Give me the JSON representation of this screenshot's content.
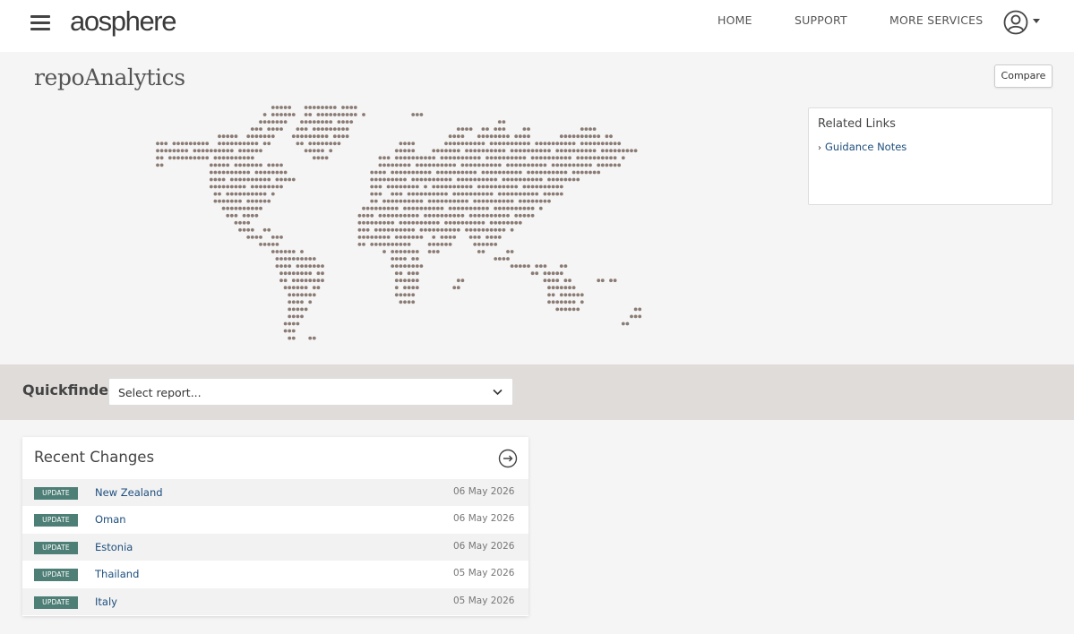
{
  "header": {
    "logo_text": "aosphere",
    "nav": [
      {
        "label": "HOME"
      },
      {
        "label": "SUPPORT"
      },
      {
        "label": "MORE SERVICES"
      }
    ]
  },
  "page": {
    "title": "repoAnalytics",
    "compare_label": "Compare"
  },
  "related_links": {
    "title": "Related Links",
    "links": [
      {
        "label": "Guidance Notes"
      }
    ]
  },
  "quickfinder": {
    "label": "Quickfinder",
    "placeholder": "Select report..."
  },
  "recent_changes": {
    "title": "Recent Changes",
    "rows": [
      {
        "badge": "UPDATE",
        "country": "New Zealand",
        "date": "06 May 2026"
      },
      {
        "badge": "UPDATE",
        "country": "Oman",
        "date": "06 May 2026"
      },
      {
        "badge": "UPDATE",
        "country": "Estonia",
        "date": "06 May 2026"
      },
      {
        "badge": "UPDATE",
        "country": "Thailand",
        "date": "05 May 2026"
      },
      {
        "badge": "UPDATE",
        "country": "Italy",
        "date": "05 May 2026"
      }
    ]
  },
  "colors": {
    "map_dot": "#8a7b74",
    "badge_bg": "#4e7f77",
    "link": "#1d4e7e",
    "band_bg": "#e0dcda"
  },
  "icons": {
    "menu": "hamburger-menu-icon",
    "account": "user-circle-icon",
    "dropdown": "chevron-down-icon",
    "link_bullet": "chevron-right-icon",
    "view_all": "circle-arrow-right-icon"
  }
}
